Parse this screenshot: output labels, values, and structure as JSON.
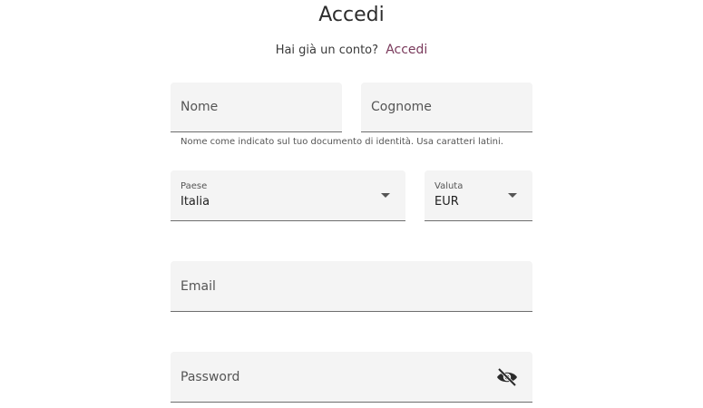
{
  "header": {
    "title": "Accedi",
    "subtitle_text": "Hai già un conto?",
    "subtitle_link": "Accedi"
  },
  "form": {
    "first_name": {
      "placeholder": "Nome"
    },
    "last_name": {
      "placeholder": "Cognome"
    },
    "name_helper": "Nome come indicato sul tuo documento di identità. Usa caratteri latini.",
    "country": {
      "label": "Paese",
      "value": "Italia"
    },
    "currency": {
      "label": "Valuta",
      "value": "EUR"
    },
    "email": {
      "placeholder": "Email"
    },
    "password": {
      "placeholder": "Password",
      "toggle_icon": "eye-off-icon"
    }
  },
  "colors": {
    "accent_link": "#7a3a5c",
    "field_background": "#f4f4f4"
  }
}
